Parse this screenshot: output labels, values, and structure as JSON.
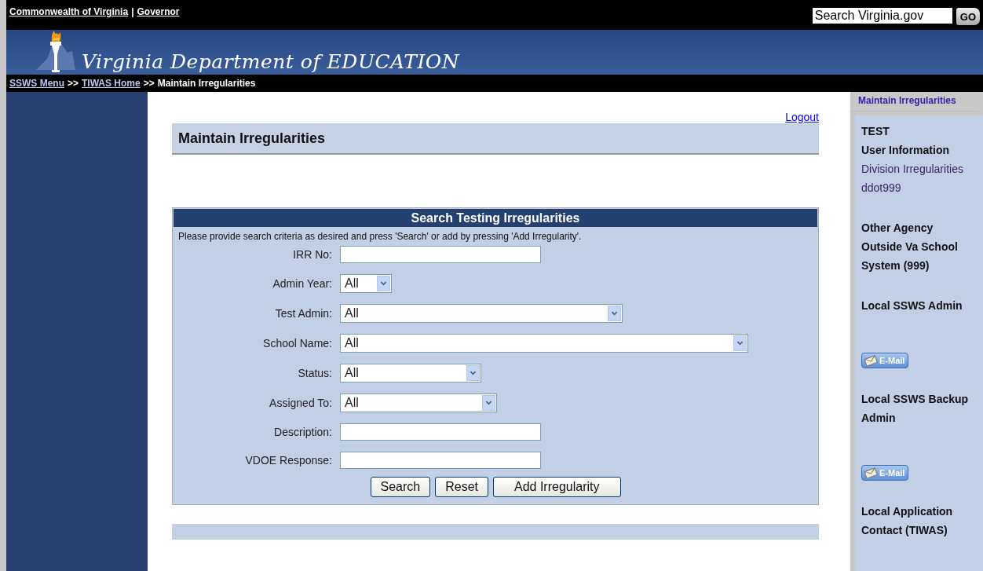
{
  "top_bar": {
    "links": [
      {
        "text": "Commonwealth of Virginia"
      },
      {
        "text": "Governor"
      }
    ],
    "separator": "|",
    "search": {
      "placeholder": "Search Virginia.gov"
    },
    "go_button": "GO"
  },
  "banner": {
    "title": "Virginia Department of EDUCATION"
  },
  "breadcrumb": {
    "links": [
      "SSWS Menu",
      "TIWAS Home"
    ],
    "separator": ">>",
    "current": "Maintain Irregularities"
  },
  "main": {
    "logout": "Logout",
    "page_title": "Maintain Irregularities",
    "search_panel": {
      "title": "Search Testing Irregularities",
      "instructions": "Please provide search criteria as desired and press 'Search' or add by pressing 'Add Irregularity'.",
      "fields": [
        {
          "kind": "text",
          "label": "IRR No:"
        },
        {
          "kind": "select",
          "label": "Admin Year:",
          "value": "All"
        },
        {
          "kind": "select",
          "label": "Test Admin:",
          "value": "All"
        },
        {
          "kind": "select",
          "label": "School Name:",
          "value": "All"
        },
        {
          "kind": "select",
          "label": "Status:",
          "value": "All"
        },
        {
          "kind": "select",
          "label": "Assigned To:",
          "value": "All"
        },
        {
          "kind": "text",
          "label": "Description:"
        },
        {
          "kind": "text",
          "label": "VDOE Response:"
        }
      ],
      "buttons": [
        "Search",
        "Reset",
        "Add Irregularity"
      ]
    }
  },
  "right_panel": {
    "title": "Maintain Irregularities",
    "sections": [
      {
        "items": [
          {
            "kind": "bold",
            "text": "TEST"
          },
          {
            "kind": "bold",
            "text": "User Information"
          },
          {
            "kind": "plain",
            "text": "Division Irregularities"
          },
          {
            "kind": "plain",
            "text": "ddot999"
          }
        ]
      },
      {
        "items": [
          {
            "kind": "bold",
            "text": "Other Agency"
          },
          {
            "kind": "bold",
            "text": "Outside Va School System (999)"
          }
        ]
      },
      {
        "items": [
          {
            "kind": "bold",
            "text": "Local SSWS Admin"
          },
          {
            "kind": "email",
            "text": "E-Mail"
          }
        ]
      },
      {
        "items": [
          {
            "kind": "bold",
            "text": "Local SSWS Backup Admin"
          },
          {
            "kind": "email",
            "text": "E-Mail"
          }
        ]
      },
      {
        "items": [
          {
            "kind": "bold",
            "text": "Local Application Contact (TIWAS)"
          }
        ]
      }
    ]
  }
}
